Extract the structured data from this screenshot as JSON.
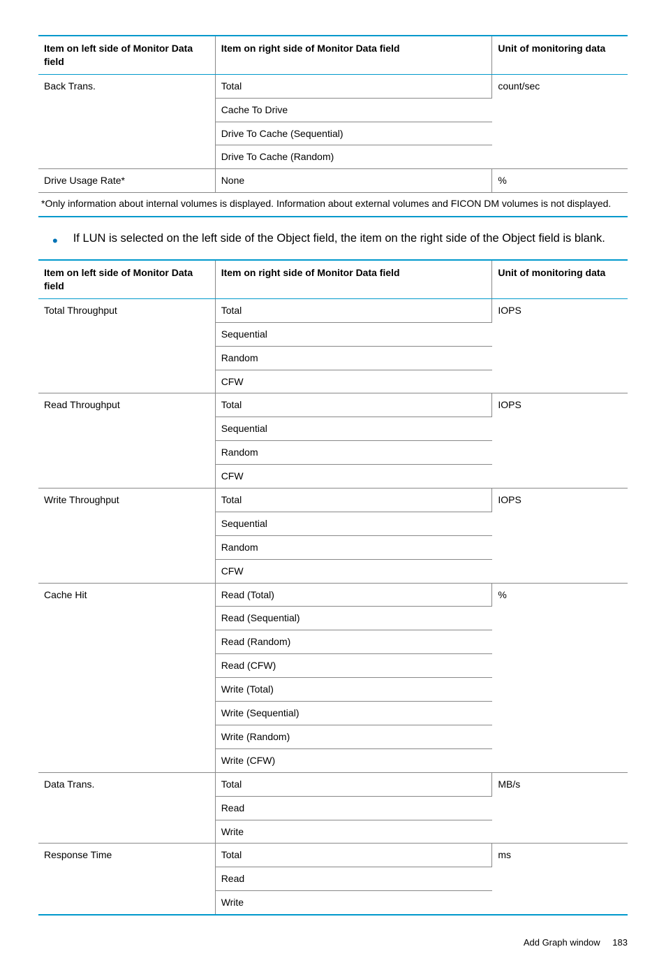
{
  "table1": {
    "headers": [
      "Item on left side of Monitor Data field",
      "Item on right side of Monitor Data field",
      "Unit of monitoring data"
    ],
    "rows": [
      {
        "left": "Back Trans.",
        "rights": [
          "Total",
          "Cache To Drive",
          "Drive To Cache (Sequential)",
          "Drive To Cache (Random)"
        ],
        "unit": "count/sec"
      },
      {
        "left": "Drive Usage Rate*",
        "rights": [
          "None"
        ],
        "unit": "%"
      }
    ],
    "footnote": "*Only information about internal volumes is displayed. Information about external volumes and FICON DM volumes is not displayed."
  },
  "bullet": "If LUN is selected on the left side of the Object field, the item on the right side of the Object field is blank.",
  "table2": {
    "headers": [
      "Item on left side of Monitor Data field",
      "Item on right side of Monitor Data field",
      "Unit of monitoring data"
    ],
    "rows": [
      {
        "left": "Total Throughput",
        "rights": [
          "Total",
          "Sequential",
          "Random",
          "CFW"
        ],
        "unit": "IOPS"
      },
      {
        "left": "Read Throughput",
        "rights": [
          "Total",
          "Sequential",
          "Random",
          "CFW"
        ],
        "unit": "IOPS"
      },
      {
        "left": "Write Throughput",
        "rights": [
          "Total",
          "Sequential",
          "Random",
          "CFW"
        ],
        "unit": "IOPS"
      },
      {
        "left": "Cache Hit",
        "rights": [
          "Read (Total)",
          "Read (Sequential)",
          "Read (Random)",
          "Read (CFW)",
          "Write (Total)",
          "Write (Sequential)",
          "Write (Random)",
          "Write (CFW)"
        ],
        "unit": "%"
      },
      {
        "left": "Data Trans.",
        "rights": [
          "Total",
          "Read",
          "Write"
        ],
        "unit": "MB/s"
      },
      {
        "left": "Response Time",
        "rights": [
          "Total",
          "Read",
          "Write"
        ],
        "unit": "ms"
      }
    ]
  },
  "footer": {
    "title": "Add Graph window",
    "page": "183"
  }
}
